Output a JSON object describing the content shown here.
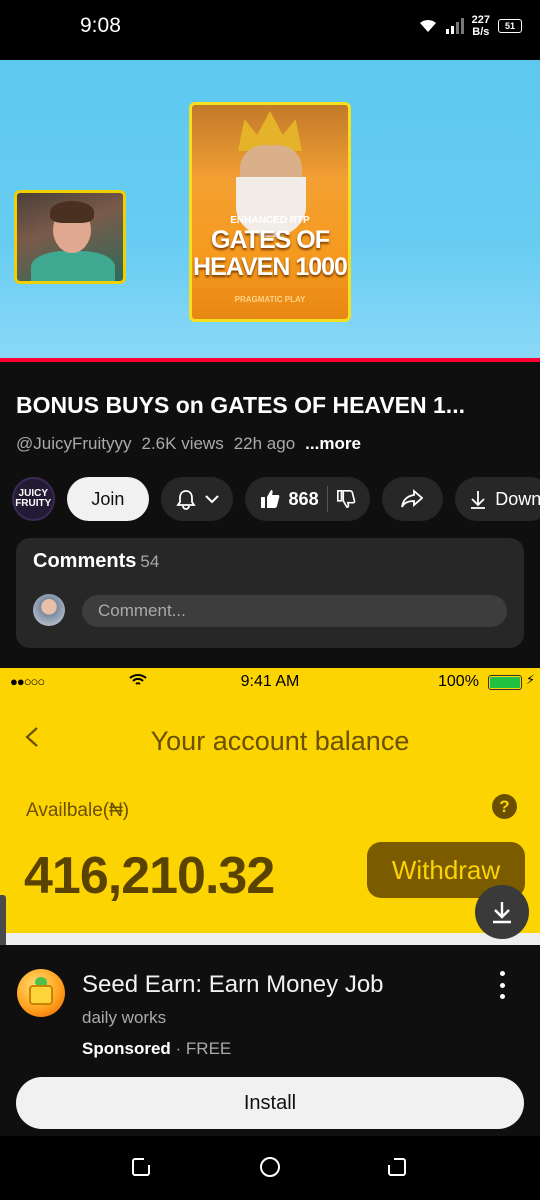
{
  "status_bar": {
    "time": "9:08",
    "speed_value": "227",
    "speed_unit": "B/s",
    "battery": "51"
  },
  "video": {
    "game_card_subtitle": "ENHANCED RTP",
    "game_card_title": "GATES OF HEAVEN 1000",
    "game_card_brand": "PRAGMATIC PLAY",
    "progress": 1.0,
    "progress_color": "#ff0033"
  },
  "info": {
    "title": "BONUS BUYS on GATES OF HEAVEN 1...",
    "channel": "@JuicyFruityyy",
    "views": "2.6K views",
    "age": "22h ago",
    "more": "...more"
  },
  "actions": {
    "channel_avatar_text": "JUICY FRUITY",
    "join": "Join",
    "likes": "868",
    "download": "Down"
  },
  "comments": {
    "label": "Comments",
    "count": "54",
    "placeholder": "Comment..."
  },
  "ad": {
    "ios_time": "9:41 AM",
    "ios_battery": "100%",
    "heading": "Your account balance",
    "available_label": "Availbale(₦)",
    "help": "?",
    "balance": "416,210.32",
    "withdraw": "Withdraw",
    "accent": "#fcd401"
  },
  "app": {
    "name": "Seed Earn: Earn Money Job",
    "subtitle": "daily works",
    "sponsored": "Sponsored",
    "price": "· FREE",
    "install": "Install"
  }
}
